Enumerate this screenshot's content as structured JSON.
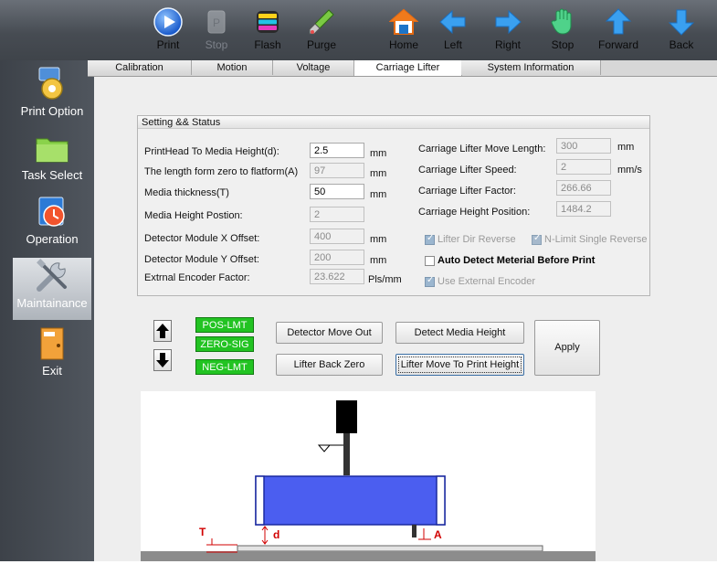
{
  "toolbar": {
    "items": [
      {
        "label": "Print",
        "icon": "print-icon",
        "enabled": true
      },
      {
        "label": "Stop",
        "icon": "pause-icon",
        "enabled": false
      },
      {
        "label": "Flash",
        "icon": "flash-icon",
        "enabled": true
      },
      {
        "label": "Purge",
        "icon": "purge-icon",
        "enabled": true
      },
      {
        "label": "Home",
        "icon": "home-icon",
        "enabled": true
      },
      {
        "label": "Left",
        "icon": "arrow-left-icon",
        "enabled": true
      },
      {
        "label": "Right",
        "icon": "arrow-right-icon",
        "enabled": true
      },
      {
        "label": "Stop",
        "icon": "hand-stop-icon",
        "enabled": true
      },
      {
        "label": "Forward",
        "icon": "arrow-up-icon",
        "enabled": true
      },
      {
        "label": "Back",
        "icon": "arrow-down-icon",
        "enabled": true
      }
    ]
  },
  "tabs": [
    {
      "label": "Calibration"
    },
    {
      "label": "Motion"
    },
    {
      "label": "Voltage"
    },
    {
      "label": "Carriage Lifter",
      "active": true
    },
    {
      "label": "System Information"
    }
  ],
  "sidebar": {
    "items": [
      {
        "label": "Print Option",
        "icon": "gear-icon"
      },
      {
        "label": "Task Select",
        "icon": "folder-icon"
      },
      {
        "label": "Operation",
        "icon": "clock-icon"
      },
      {
        "label": "Maintainance",
        "icon": "tools-icon",
        "active": true
      },
      {
        "label": "Exit",
        "icon": "door-icon"
      }
    ]
  },
  "group": {
    "title": "Setting && Status",
    "left_fields": [
      {
        "label": "PrintHead To Media Height(d):",
        "value": "2.5",
        "unit": "mm",
        "editable": true
      },
      {
        "label": "The length form zero to flatform(A)",
        "value": "97",
        "unit": "mm",
        "editable": false
      },
      {
        "label": "Media thickness(T)",
        "value": "50",
        "unit": "mm",
        "editable": true
      },
      {
        "label": "Media Height Postion:",
        "value": "2",
        "unit": "",
        "editable": false
      },
      {
        "label": "Detector Module X Offset:",
        "value": "400",
        "unit": "mm",
        "editable": false
      },
      {
        "label": "Detector Module Y Offset:",
        "value": "200",
        "unit": "mm",
        "editable": false
      },
      {
        "label": "Extrnal Encoder Factor:",
        "value": "23.622",
        "unit": "Pls/mm",
        "editable": false
      }
    ],
    "right_fields": [
      {
        "label": "Carriage Lifter Move Length:",
        "value": "300",
        "unit": "mm"
      },
      {
        "label": "Carriage Lifter Speed:",
        "value": "2",
        "unit": "mm/s"
      },
      {
        "label": "Carriage Lifter Factor:",
        "value": "266.66",
        "unit": ""
      },
      {
        "label": "Carriage Height Position:",
        "value": "1484.2",
        "unit": ""
      }
    ],
    "checkboxes": {
      "lifter_dir_reverse": "Lifter Dir Reverse",
      "n_limit_single_reverse": "N-Limit Single Reverse",
      "auto_detect": "Auto Detect Meterial Before  Print",
      "use_external_encoder": "Use External Encoder"
    }
  },
  "controls": {
    "status": {
      "pos": "POS-LMT",
      "zero": "ZERO-SIG",
      "neg": "NEG-LMT"
    },
    "buttons": {
      "detector_move_out": "Detector Move Out",
      "detect_media_height": "Detect Media Height",
      "lifter_back_zero": "Lifter Back Zero",
      "lifter_move_to_print_height": "Lifter Move To Print Height",
      "apply": "Apply"
    }
  },
  "diagram": {
    "labels": {
      "t": "T",
      "d": "d",
      "a": "A"
    }
  },
  "colors": {
    "status_green": "#22c322",
    "media_blue": "#4b5ef0",
    "marker_red": "#d10000"
  }
}
